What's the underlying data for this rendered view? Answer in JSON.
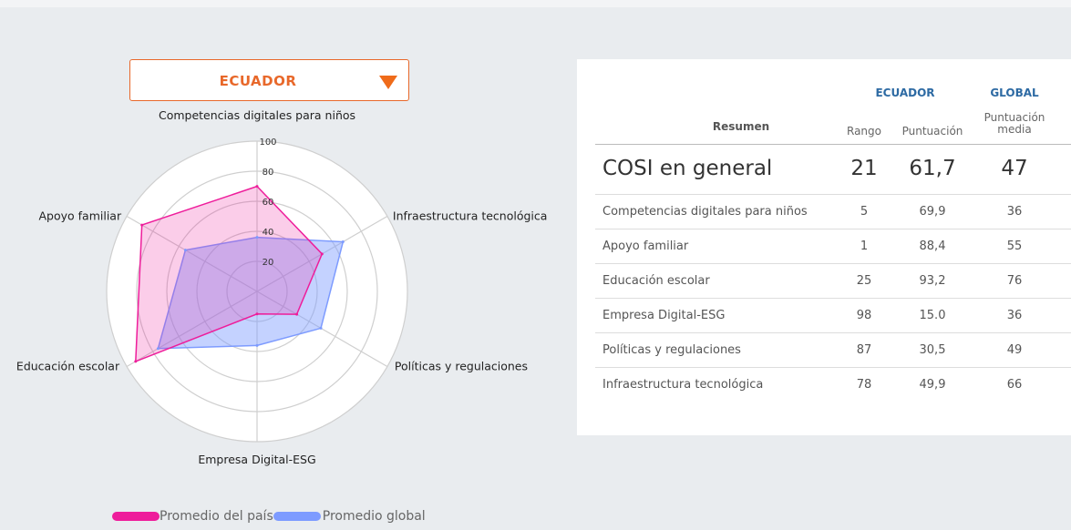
{
  "country_selector": {
    "selected": "ECUADOR"
  },
  "legend": [
    {
      "label": "Promedio del país",
      "color": "#ee1d9b"
    },
    {
      "label": "Promedio global",
      "color": "#7d9bff"
    }
  ],
  "chart_data": {
    "type": "radar",
    "axes": [
      "Competencias digitales para niños",
      "Infraestructura tecnológica",
      "Políticas y regulaciones",
      "Empresa Digital-ESG",
      "Educación escolar",
      "Apoyo familiar"
    ],
    "rlim": [
      0,
      100
    ],
    "ticks": [
      "20",
      "40",
      "60",
      "80",
      "100"
    ],
    "series": [
      {
        "name": "Promedio del país",
        "values": [
          69.9,
          49.9,
          30.5,
          15.0,
          93.2,
          88.4
        ],
        "color": "#ee1d9b"
      },
      {
        "name": "Promedio global",
        "values": [
          36,
          66,
          49,
          36,
          76,
          55
        ],
        "color": "#7d9bff"
      }
    ]
  },
  "table": {
    "country_header": "ECUADOR",
    "global_header": "GLOBAL",
    "col_summary": "Resumen",
    "col_rank": "Rango",
    "col_score": "Puntuación",
    "col_global": "Puntuación media",
    "overall": {
      "name": "COSI en general",
      "rank": "21",
      "score": "61,7",
      "global": "47"
    },
    "rows": [
      {
        "name": "Competencias digitales para niños",
        "rank": "5",
        "score": "69,9",
        "global": "36"
      },
      {
        "name": "Apoyo familiar",
        "rank": "1",
        "score": "88,4",
        "global": "55"
      },
      {
        "name": "Educación escolar",
        "rank": "25",
        "score": "93,2",
        "global": "76"
      },
      {
        "name": "Empresa Digital-ESG",
        "rank": "98",
        "score": "15.0",
        "global": "36"
      },
      {
        "name": "Políticas y regulaciones",
        "rank": "87",
        "score": "30,5",
        "global": "49"
      },
      {
        "name": "Infraestructura tecnológica",
        "rank": "78",
        "score": "49,9",
        "global": "66"
      }
    ]
  }
}
